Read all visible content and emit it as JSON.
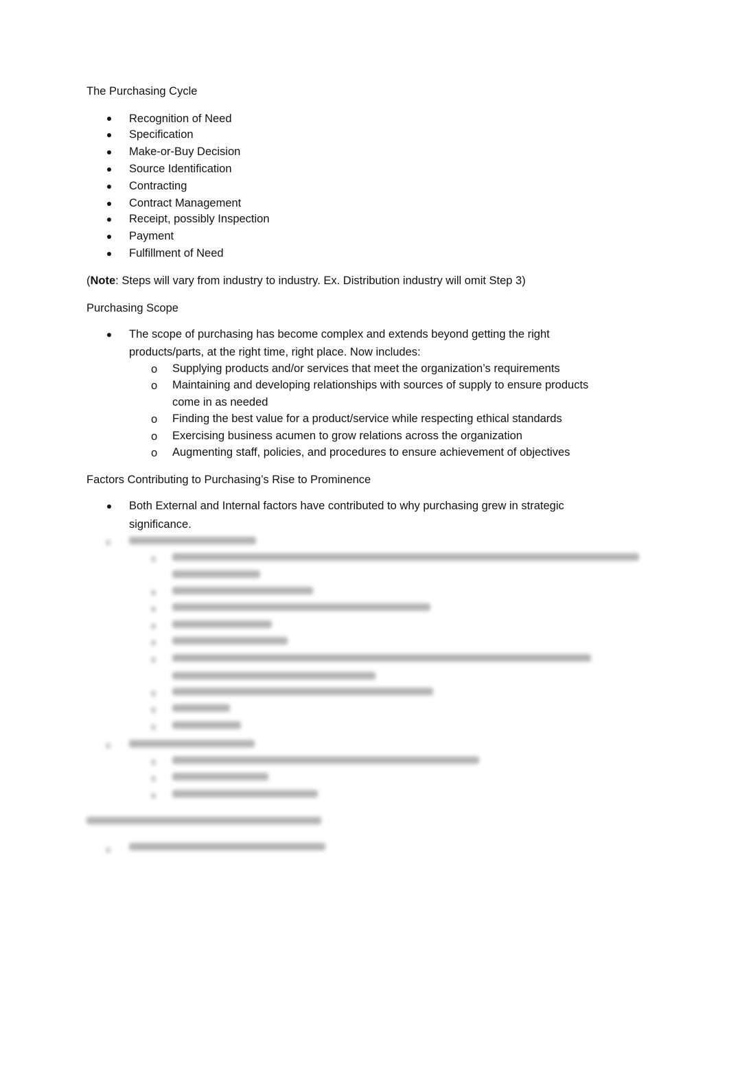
{
  "document": {
    "sections": [
      {
        "heading": "The Purchasing Cycle",
        "bullets": [
          "Recognition of Need",
          "Specification",
          "Make-or-Buy Decision",
          "Source Identification",
          "Contracting",
          "Contract Management",
          "Receipt, possibly Inspection",
          "Payment",
          "Fulfillment of Need"
        ]
      }
    ],
    "note": {
      "open_paren": "(",
      "label": "Note",
      "text": ": Steps will vary from industry to industry. Ex. Distribution industry will omit Step 3)"
    },
    "scope": {
      "heading": "Purchasing Scope",
      "bullet_line1": "The scope of purchasing has become complex and extends beyond getting the right",
      "bullet_line2": "products/parts, at the right time, right place. Now includes:",
      "sub_marker": "o",
      "sub_items": [
        "Supplying products and/or services that meet the organization’s requirements",
        "Maintaining and developing relationships with sources of supply to ensure products",
        "come in as needed",
        "Finding the best value for a product/service while respecting ethical standards",
        "Exercising business acumen to grow relations across the organization",
        "Augmenting staff, policies, and procedures to ensure achievement of objectives"
      ]
    },
    "factors": {
      "heading": "Factors Contributing to Purchasing’s Rise to Prominence",
      "bullet_line1": "Both External and Internal factors have contributed to why purchasing grew in strategic",
      "bullet_line2": "significance."
    },
    "blurred_preview": {
      "visible": true,
      "description": "remaining content obscured by preview blur"
    }
  }
}
